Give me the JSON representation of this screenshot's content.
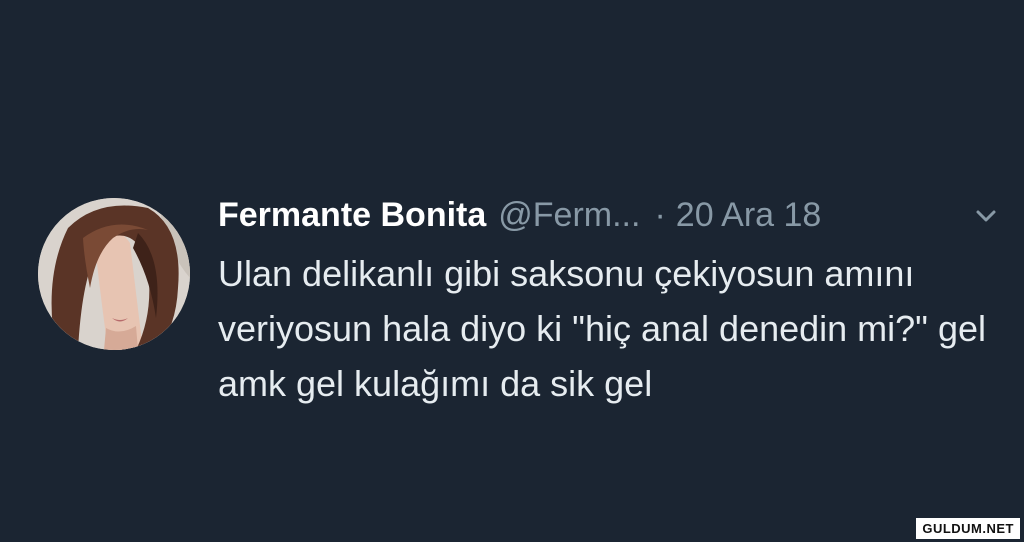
{
  "tweet": {
    "display_name": "Fermante Bonita",
    "handle": "@Ferm...",
    "separator": "·",
    "date": "20 Ara 18",
    "text": "Ulan delikanlı gibi saksonu çekiyosun amını veriyosun hala diyo ki \"hiç anal denedin mi?\" gel amk gel kulağımı da sik gel",
    "menu_icon": "chevron-down-icon",
    "avatar_icon": "profile-photo"
  },
  "watermark": {
    "text": "GULDUM.NET"
  },
  "colors": {
    "background": "#1b2532",
    "name": "#ffffff",
    "muted": "#8899a6",
    "text": "#e6ecf0"
  }
}
